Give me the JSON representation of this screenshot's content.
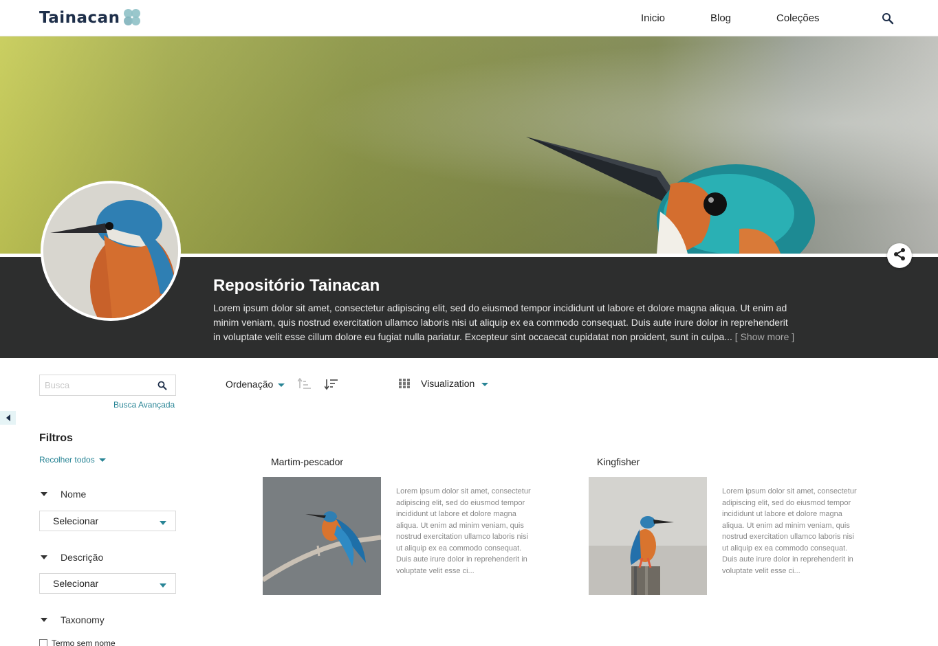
{
  "header": {
    "logo_text": "Tainacan",
    "nav": [
      "Inicio",
      "Blog",
      "Coleções"
    ],
    "search_icon": "search-icon"
  },
  "collection": {
    "title": "Repositório Tainacan",
    "description": "Lorem ipsum dolor sit amet, consectetur adipiscing elit, sed do eiusmod tempor incididunt ut labore et dolore magna aliqua. Ut enim ad minim veniam, quis nostrud exercitation ullamco laboris nisi ut aliquip ex ea commodo consequat. Duis aute irure dolor in reprehenderit in voluptate velit esse cillum dolore eu fugiat nulla pariatur. Excepteur sint occaecat cupidatat non proident, sunt in culpa...",
    "show_more": "[ Show more ]",
    "share_icon": "share-icon"
  },
  "sidebar": {
    "search_placeholder": "Busca",
    "advanced_search": "Busca Avançada",
    "filters_title": "Filtros",
    "collapse_all": "Recolher todos",
    "filters": [
      {
        "label": "Nome",
        "select": "Selecionar"
      },
      {
        "label": "Descrição",
        "select": "Selecionar"
      },
      {
        "label": "Taxonomy",
        "option": "Termo sem nome"
      }
    ]
  },
  "toolbar": {
    "sort_label": "Ordenação",
    "view_label": "Visualization"
  },
  "items": [
    {
      "title": "Martim-pescador",
      "excerpt": "Lorem ipsum dolor sit amet, consectetur adipiscing elit, sed do eiusmod tempor incididunt ut labore et dolore magna aliqua. Ut enim ad minim veniam, quis nostrud exercitation ullamco laboris nisi ut aliquip ex ea commodo consequat. Duis aute irure dolor in reprehenderit in voluptate velit esse ci..."
    },
    {
      "title": "Kingfisher",
      "excerpt": "Lorem ipsum dolor sit amet, consectetur adipiscing elit, sed do eiusmod tempor incididunt ut labore et dolore magna aliqua. Ut enim ad minim veniam, quis nostrud exercitation ullamco laboris nisi ut aliquip ex ea commodo consequat. Duis aute irure dolor in reprehenderit in voluptate velit esse ci..."
    }
  ],
  "colors": {
    "accent": "#298596",
    "dark_band": "#2d2e2e",
    "logo": "#1d2e49"
  }
}
